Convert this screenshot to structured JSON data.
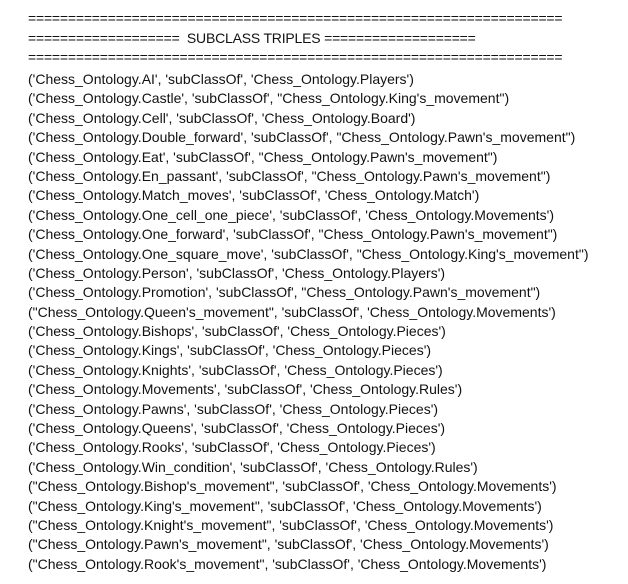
{
  "document": {
    "separator_top": "===================================================================",
    "header_line": "===================  SUBCLASS TRIPLES ===================",
    "separator_bottom": "===================================================================",
    "triples": [
      "('Chess_Ontology.AI', 'subClassOf', 'Chess_Ontology.Players')",
      "('Chess_Ontology.Castle', 'subClassOf', \"Chess_Ontology.King's_movement\")",
      "('Chess_Ontology.Cell', 'subClassOf', 'Chess_Ontology.Board')",
      "('Chess_Ontology.Double_forward', 'subClassOf', \"Chess_Ontology.Pawn's_movement\")",
      "('Chess_Ontology.Eat', 'subClassOf', \"Chess_Ontology.Pawn's_movement\")",
      "('Chess_Ontology.En_passant', 'subClassOf', \"Chess_Ontology.Pawn's_movement\")",
      "('Chess_Ontology.Match_moves', 'subClassOf', 'Chess_Ontology.Match')",
      "('Chess_Ontology.One_cell_one_piece', 'subClassOf', 'Chess_Ontology.Movements')",
      "('Chess_Ontology.One_forward', 'subClassOf', \"Chess_Ontology.Pawn's_movement\")",
      "('Chess_Ontology.One_square_move', 'subClassOf', \"Chess_Ontology.King's_movement\")",
      "('Chess_Ontology.Person', 'subClassOf', 'Chess_Ontology.Players')",
      "('Chess_Ontology.Promotion', 'subClassOf', \"Chess_Ontology.Pawn's_movement\")",
      "(\"Chess_Ontology.Queen's_movement\", 'subClassOf', 'Chess_Ontology.Movements')",
      "('Chess_Ontology.Bishops', 'subClassOf', 'Chess_Ontology.Pieces')",
      "('Chess_Ontology.Kings', 'subClassOf', 'Chess_Ontology.Pieces')",
      "('Chess_Ontology.Knights', 'subClassOf', 'Chess_Ontology.Pieces')",
      "('Chess_Ontology.Movements', 'subClassOf', 'Chess_Ontology.Rules')",
      "('Chess_Ontology.Pawns', 'subClassOf', 'Chess_Ontology.Pieces')",
      "('Chess_Ontology.Queens', 'subClassOf', 'Chess_Ontology.Pieces')",
      "('Chess_Ontology.Rooks', 'subClassOf', 'Chess_Ontology.Pieces')",
      "('Chess_Ontology.Win_condition', 'subClassOf', 'Chess_Ontology.Rules')",
      "(\"Chess_Ontology.Bishop's_movement\", 'subClassOf', 'Chess_Ontology.Movements')",
      "(\"Chess_Ontology.King's_movement\", 'subClassOf', 'Chess_Ontology.Movements')",
      "(\"Chess_Ontology.Knight's_movement\", 'subClassOf', 'Chess_Ontology.Movements')",
      "(\"Chess_Ontology.Pawn's_movement\", 'subClassOf', 'Chess_Ontology.Movements')",
      "(\"Chess_Ontology.Rook's_movement\", 'subClassOf', 'Chess_Ontology.Movements')"
    ]
  }
}
